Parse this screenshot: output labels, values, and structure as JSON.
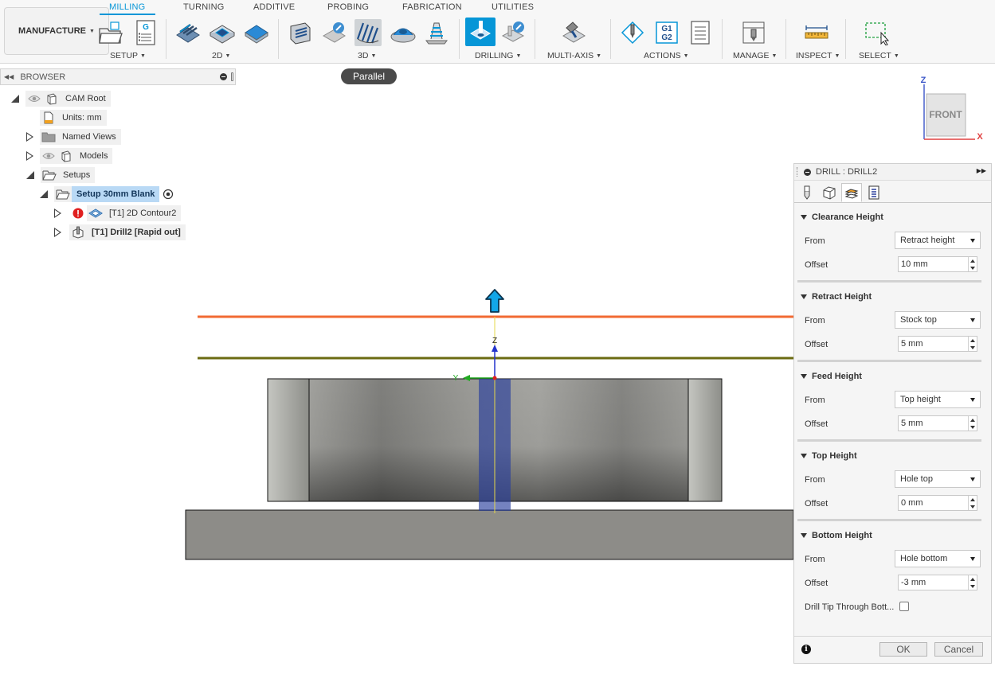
{
  "workspace": {
    "label": "MANUFACTURE"
  },
  "tabs": [
    "MILLING",
    "TURNING",
    "ADDITIVE",
    "PROBING",
    "FABRICATION",
    "UTILITIES"
  ],
  "groups": {
    "setup": "SETUP",
    "twod": "2D",
    "threed": "3D",
    "drilling": "DRILLING",
    "multiaxis": "MULTI-AXIS",
    "actions": "ACTIONS",
    "manage": "MANAGE",
    "inspect": "INSPECT",
    "select": "SELECT"
  },
  "icons": {
    "nc_program": "G",
    "post": "G1\nG2",
    "post_line1": "G1",
    "post_line2": "G2"
  },
  "tooltip": "Parallel",
  "browser": {
    "title": "BROWSER",
    "tree": {
      "cam_root": "CAM Root",
      "units": "Units: mm",
      "named_views": "Named Views",
      "models": "Models",
      "setups": "Setups",
      "setup_item": "Setup 30mm Blank",
      "op1": "[T1] 2D Contour2",
      "op2": "[T1] Drill2 [Rapid out]"
    }
  },
  "viewcube": {
    "face": "FRONT",
    "z_axis": "Z",
    "x_axis": "X"
  },
  "viewport": {
    "z_axis": "Z",
    "y_axis": "Y"
  },
  "panel": {
    "title": "DRILL : DRILL2",
    "from_label": "From",
    "offset_label": "Offset",
    "sections": [
      {
        "title": "Clearance Height",
        "from": "Retract height",
        "offset": "10 mm"
      },
      {
        "title": "Retract Height",
        "from": "Stock top",
        "offset": "5 mm"
      },
      {
        "title": "Feed Height",
        "from": "Top height",
        "offset": "5 mm"
      },
      {
        "title": "Top Height",
        "from": "Hole top",
        "offset": "0 mm"
      },
      {
        "title": "Bottom Height",
        "from": "Hole bottom",
        "offset": "-3 mm"
      }
    ],
    "drill_tip_label": "Drill Tip Through Bott...",
    "drill_tip_checked": false,
    "ok": "OK",
    "cancel": "Cancel"
  },
  "colors": {
    "accent": "#0696d7",
    "clearance_line": "#f26a33",
    "retract_line": "#6b6b12",
    "drill_volume": "#2a3f9c"
  }
}
